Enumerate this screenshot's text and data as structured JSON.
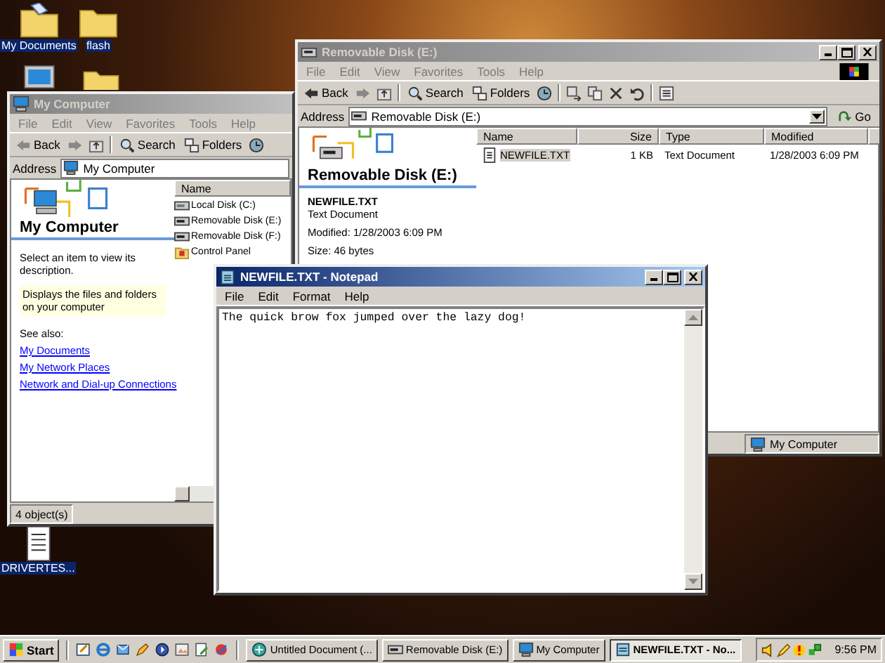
{
  "desktop_icons": [
    {
      "kind": "documents",
      "label": "My Documents",
      "selected": true
    },
    {
      "kind": "folder",
      "label": "flash",
      "selected": true
    },
    {
      "kind": "computer"
    },
    {
      "kind": "folder"
    },
    {
      "kind": "text-file",
      "label": "DRIVERTES...",
      "selected": true
    }
  ],
  "my_computer_window": {
    "title": "My Computer",
    "active": false,
    "menu": [
      "File",
      "Edit",
      "View",
      "Favorites",
      "Tools",
      "Help"
    ],
    "back": "Back",
    "search": "Search",
    "folders": "Folders",
    "address_label": "Address",
    "address": "My Computer",
    "heading": "My Computer",
    "hint": "Select an item to view its description.",
    "info": "Displays the files and folders on your computer",
    "see_also": "See also:",
    "links": [
      "My Documents",
      "My Network Places",
      "Network and Dial-up Connections"
    ],
    "column": "Name",
    "items": [
      {
        "kind": "hdd",
        "name": "Local Disk (C:)"
      },
      {
        "kind": "removable",
        "name": "Removable Disk (E:)"
      },
      {
        "kind": "removable",
        "name": "Removable Disk (F:)"
      },
      {
        "kind": "control-panel",
        "name": "Control Panel"
      }
    ],
    "status": "4 object(s)"
  },
  "removable_disk_window": {
    "title": "Removable Disk (E:)",
    "active": false,
    "menu": [
      "File",
      "Edit",
      "View",
      "Favorites",
      "Tools",
      "Help"
    ],
    "back": "Back",
    "search": "Search",
    "folders": "Folders",
    "address_label": "Address",
    "address": "Removable Disk (E:)",
    "go": "Go",
    "heading": "Removable Disk (E:)",
    "file_name": "NEWFILE.TXT",
    "file_type": "Text Document",
    "modified": "Modified: 1/28/2003 6:09 PM",
    "size": "Size: 46 bytes",
    "columns": [
      "Name",
      "Size",
      "Type",
      "Modified"
    ],
    "rows": [
      {
        "name": "NEWFILE.TXT",
        "size": "1 KB",
        "type": "Text Document",
        "modified": "1/28/2003 6:09 PM",
        "selected": true
      }
    ],
    "status_location": "My Computer"
  },
  "notepad_window": {
    "title": "NEWFILE.TXT - Notepad",
    "active": true,
    "menu": [
      "File",
      "Edit",
      "Format",
      "Help"
    ],
    "text": "The quick brow fox jumped over the lazy dog!"
  },
  "taskbar": {
    "start": "Start",
    "tasks": [
      {
        "kind": "web",
        "label": "Untitled Document (...",
        "selected": false
      },
      {
        "kind": "drive",
        "label": "Removable Disk (E:)",
        "selected": false
      },
      {
        "kind": "computer",
        "label": "My Computer",
        "selected": false
      },
      {
        "kind": "notepad",
        "label": "NEWFILE.TXT - No...",
        "selected": true
      }
    ],
    "clock": "9:56 PM"
  }
}
